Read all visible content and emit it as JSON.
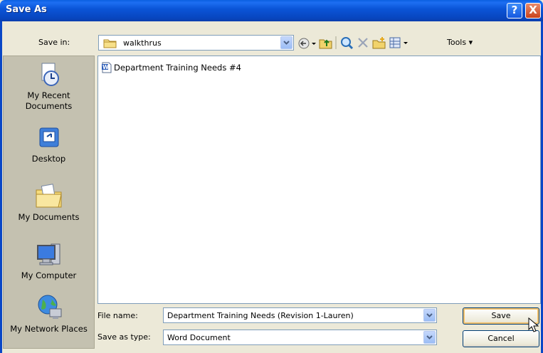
{
  "window": {
    "title": "Save As",
    "help_label": "?",
    "close_label": "X"
  },
  "save_in": {
    "label": "Save in:",
    "value": "walkthrus"
  },
  "toolbar": {
    "icons": [
      "back-icon",
      "up-folder-icon",
      "search-web-icon",
      "delete-icon",
      "new-folder-icon",
      "views-icon"
    ],
    "tools_label": "Tools"
  },
  "places": [
    {
      "name": "my-recent-documents",
      "label": "My Recent Documents",
      "icon": "recent-documents-icon"
    },
    {
      "name": "desktop",
      "label": "Desktop",
      "icon": "desktop-icon"
    },
    {
      "name": "my-documents",
      "label": "My Documents",
      "icon": "my-documents-icon"
    },
    {
      "name": "my-computer",
      "label": "My Computer",
      "icon": "my-computer-icon"
    },
    {
      "name": "my-network-places",
      "label": "My Network Places",
      "icon": "network-places-icon"
    }
  ],
  "files": [
    {
      "name": "Department Training Needs #4",
      "icon": "word-document-icon"
    }
  ],
  "file_name": {
    "label": "File name:",
    "value": "Department Training Needs (Revision 1-Lauren)"
  },
  "save_as_type": {
    "label": "Save as type:",
    "value": "Word Document"
  },
  "buttons": {
    "save": "Save",
    "cancel": "Cancel"
  },
  "colors": {
    "titlebar": "#0a55d8",
    "dialog_bg": "#ece9d8",
    "places_bg": "#c4c1b0",
    "default_button_glow": "#f5c26b"
  }
}
